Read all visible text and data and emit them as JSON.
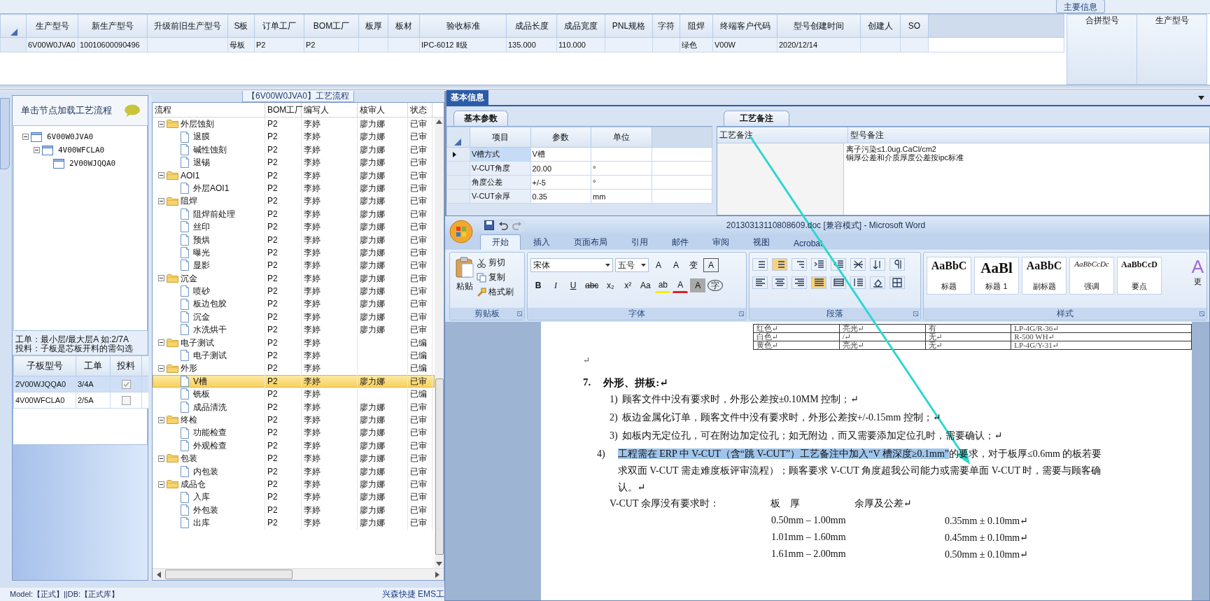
{
  "top_panel": {
    "title": "主要信息",
    "main_table": {
      "columns": [
        "生产型号",
        "新生产型号",
        "升级前旧生产型号",
        "S板",
        "订单工厂",
        "BOM工厂",
        "板厚",
        "板材",
        "验收标准",
        "成品长度",
        "成品宽度",
        "PNL规格",
        "字符",
        "阻焊",
        "终端客户代码",
        "型号创建时间",
        "创建人",
        "SO"
      ],
      "rows": [
        [
          "6V00W0JVA0",
          "10010600090496",
          null,
          "母板",
          "P2",
          "P2",
          null,
          null,
          "IPC-6012 Ⅱ级",
          "135.000",
          "110.000",
          null,
          null,
          "绿色",
          "V00W",
          "2020/12/14",
          null,
          null
        ]
      ]
    },
    "merge_table": {
      "columns": [
        "合拼型号",
        "生产型号"
      ]
    }
  },
  "left_panel": {
    "hint": "单击节点加载工艺流程",
    "tree": [
      {
        "label": "6V00W0JVA0",
        "expanded": true,
        "children": [
          {
            "label": "4V00WFCLA0",
            "expanded": true,
            "children": [
              {
                "label": "2V00WJQQA0"
              }
            ]
          }
        ]
      }
    ],
    "notes": [
      "工单：最小层/最大层A 如:2/7A",
      "投料：子板是芯板开料的需勾选"
    ],
    "sub_table": {
      "columns": [
        "子板型号",
        "工单",
        "投料"
      ],
      "rows": [
        {
          "cells": [
            "2V00WJQQA0",
            "3/4A"
          ],
          "checked": true,
          "selected": true
        },
        {
          "cells": [
            "4V00WFCLA0",
            "2/5A"
          ],
          "checked": false,
          "selected": false
        }
      ]
    }
  },
  "process_panel": {
    "title": "【6V00W0JVA0】工艺流程",
    "columns": [
      "流程",
      "BOM工厂",
      "编写人",
      "核审人",
      "状态"
    ],
    "steps": [
      {
        "label": "外层蚀刻",
        "kind": "folder",
        "factory": "P2",
        "writer": "李婷",
        "reviewer": "廖力娜",
        "status": "已审",
        "expanded": true,
        "selected": false,
        "children": [
          {
            "label": "退膜",
            "kind": "doc",
            "factory": "P2",
            "writer": "李婷",
            "reviewer": "廖力娜",
            "status": "已审",
            "selected": false
          },
          {
            "label": "碱性蚀刻",
            "kind": "doc",
            "factory": "P2",
            "writer": "李婷",
            "reviewer": "廖力娜",
            "status": "已审",
            "selected": false
          },
          {
            "label": "退锡",
            "kind": "doc",
            "factory": "P2",
            "writer": "李婷",
            "reviewer": "廖力娜",
            "status": "已审",
            "selected": false
          }
        ]
      },
      {
        "label": "AOI1",
        "kind": "folder",
        "factory": "P2",
        "writer": "李婷",
        "reviewer": "廖力娜",
        "status": "已审",
        "expanded": true,
        "selected": false,
        "children": [
          {
            "label": "外层AOI1",
            "kind": "doc",
            "factory": "P2",
            "writer": "李婷",
            "reviewer": "廖力娜",
            "status": "已审",
            "selected": false
          }
        ]
      },
      {
        "label": "阻焊",
        "kind": "folder",
        "factory": "P2",
        "writer": "李婷",
        "reviewer": "廖力娜",
        "status": "已审",
        "expanded": true,
        "selected": false,
        "children": [
          {
            "label": "阻焊前处理",
            "kind": "doc",
            "factory": "P2",
            "writer": "李婷",
            "reviewer": "廖力娜",
            "status": "已审",
            "selected": false
          },
          {
            "label": "丝印",
            "kind": "doc",
            "factory": "P2",
            "writer": "李婷",
            "reviewer": "廖力娜",
            "status": "已审",
            "selected": false
          },
          {
            "label": "预烘",
            "kind": "doc",
            "factory": "P2",
            "writer": "李婷",
            "reviewer": "廖力娜",
            "status": "已审",
            "selected": false
          },
          {
            "label": "曝光",
            "kind": "doc",
            "factory": "P2",
            "writer": "李婷",
            "reviewer": "廖力娜",
            "status": "已审",
            "selected": false
          },
          {
            "label": "显影",
            "kind": "doc",
            "factory": "P2",
            "writer": "李婷",
            "reviewer": "廖力娜",
            "status": "已审",
            "selected": false
          }
        ]
      },
      {
        "label": "沉金",
        "kind": "folder",
        "factory": "P2",
        "writer": "李婷",
        "reviewer": "廖力娜",
        "status": "已审",
        "expanded": true,
        "selected": false,
        "children": [
          {
            "label": "喷砂",
            "kind": "doc",
            "factory": "P2",
            "writer": "李婷",
            "reviewer": "廖力娜",
            "status": "已审",
            "selected": false
          },
          {
            "label": "板边包胶",
            "kind": "doc",
            "factory": "P2",
            "writer": "李婷",
            "reviewer": "廖力娜",
            "status": "已审",
            "selected": false
          },
          {
            "label": "沉金",
            "kind": "doc",
            "factory": "P2",
            "writer": "李婷",
            "reviewer": "廖力娜",
            "status": "已审",
            "selected": false
          },
          {
            "label": "水洗烘干",
            "kind": "doc",
            "factory": "P2",
            "writer": "李婷",
            "reviewer": "廖力娜",
            "status": "已审",
            "selected": false
          }
        ]
      },
      {
        "label": "电子测试",
        "kind": "folder",
        "factory": "P2",
        "writer": "李婷",
        "status": "已编",
        "expanded": true,
        "selected": false,
        "children": [
          {
            "label": "电子测试",
            "kind": "doc",
            "factory": "P2",
            "writer": "李婷",
            "status": "已编",
            "selected": false
          }
        ]
      },
      {
        "label": "外形",
        "kind": "folder",
        "factory": "P2",
        "writer": "李婷",
        "status": "已编",
        "expanded": true,
        "selected": false,
        "children": [
          {
            "label": "V槽",
            "kind": "doc",
            "factory": "P2",
            "writer": "李婷",
            "reviewer": "廖力娜",
            "status": "已审",
            "selected": true
          },
          {
            "label": "铣板",
            "kind": "doc",
            "factory": "P2",
            "writer": "李婷",
            "status": "已编",
            "selected": false
          },
          {
            "label": "成品清洗",
            "kind": "doc",
            "factory": "P2",
            "writer": "李婷",
            "reviewer": "廖力娜",
            "status": "已审",
            "selected": false
          }
        ]
      },
      {
        "label": "终检",
        "kind": "folder",
        "factory": "P2",
        "writer": "李婷",
        "reviewer": "廖力娜",
        "status": "已审",
        "expanded": true,
        "selected": false,
        "children": [
          {
            "label": "功能检查",
            "kind": "doc",
            "factory": "P2",
            "writer": "李婷",
            "reviewer": "廖力娜",
            "status": "已审",
            "selected": false
          },
          {
            "label": "外观检查",
            "kind": "doc",
            "factory": "P2",
            "writer": "李婷",
            "reviewer": "廖力娜",
            "status": "已审",
            "selected": false
          }
        ]
      },
      {
        "label": "包装",
        "kind": "folder",
        "factory": "P2",
        "writer": "李婷",
        "reviewer": "廖力娜",
        "status": "已审",
        "expanded": true,
        "selected": false,
        "children": [
          {
            "label": "内包装",
            "kind": "doc",
            "factory": "P2",
            "writer": "李婷",
            "reviewer": "廖力娜",
            "status": "已审",
            "selected": false
          }
        ]
      },
      {
        "label": "成品仓",
        "kind": "folder",
        "factory": "P2",
        "writer": "李婷",
        "reviewer": "廖力娜",
        "status": "已审",
        "expanded": true,
        "selected": false,
        "children": [
          {
            "label": "入库",
            "kind": "doc",
            "factory": "P2",
            "writer": "李婷",
            "reviewer": "廖力娜",
            "status": "已审",
            "selected": false
          },
          {
            "label": "外包装",
            "kind": "doc",
            "factory": "P2",
            "writer": "李婷",
            "reviewer": "廖力娜",
            "status": "已审",
            "selected": false
          },
          {
            "label": "出库",
            "kind": "doc",
            "factory": "P2",
            "writer": "李婷",
            "reviewer": "廖力娜",
            "status": "已审",
            "selected": false
          }
        ]
      }
    ]
  },
  "info_panel": {
    "tab": "基本信息",
    "params": {
      "tab": "基本参数",
      "columns": [
        "项目",
        "参数",
        "单位"
      ],
      "rows": [
        {
          "cells": [
            "V槽方式",
            "V槽"
          ],
          "selected": true
        },
        {
          "cells": [
            "V-CUT角度",
            "20.00",
            "°"
          ],
          "selected": false
        },
        {
          "cells": [
            "角度公差",
            "+/-5",
            "°"
          ],
          "selected": false
        },
        {
          "cells": [
            "V-CUT余厚",
            "0.35",
            "mm"
          ],
          "selected": false
        }
      ]
    },
    "remarks": {
      "tab": "工艺备注",
      "columns": [
        "工艺备注",
        "型号备注"
      ],
      "model_notes": [
        "离子污染≤1.0ug.CaCl/cm2",
        "铜厚公差和介质厚度公差按ipc标准"
      ]
    }
  },
  "word": {
    "title": "20130313110808609.doc [兼容模式] - Microsoft Word",
    "tabs": [
      {
        "label": "开始",
        "selected": true
      },
      {
        "label": "插入",
        "selected": false
      },
      {
        "label": "页面布局",
        "selected": false
      },
      {
        "label": "引用",
        "selected": false
      },
      {
        "label": "邮件",
        "selected": false
      },
      {
        "label": "审阅",
        "selected": false
      },
      {
        "label": "视图",
        "selected": false
      },
      {
        "label": "Acrobat",
        "selected": false
      }
    ],
    "clipboard": {
      "paste": "粘贴",
      "items": [
        "剪切",
        "复制",
        "格式刷"
      ],
      "label": "剪贴板"
    },
    "font": {
      "name": "宋体",
      "size": "五号",
      "tools": [
        "A",
        "A",
        "变",
        "A"
      ],
      "buttons": [
        {
          "label": "B",
          "kind": "bold"
        },
        {
          "label": "I",
          "kind": "italic"
        },
        {
          "label": "U",
          "kind": "underline"
        },
        {
          "label": "abc",
          "kind": "strike"
        },
        {
          "label": "x₂",
          "kind": "plain"
        },
        {
          "label": "x²",
          "kind": "plain"
        },
        {
          "label": "Aa",
          "kind": "plain"
        },
        {
          "label": "ab",
          "kind": "highlight"
        },
        {
          "label": "A",
          "kind": "color"
        },
        {
          "label": "A",
          "kind": "shade"
        },
        {
          "label": "字",
          "kind": "circle"
        }
      ],
      "label": "字体"
    },
    "paragraph": {
      "label": "段落",
      "row1": [
        {
          "kind": "bullets",
          "on": false
        },
        {
          "kind": "numbering",
          "on": true
        },
        {
          "kind": "multilevel",
          "on": false
        },
        {
          "kind": "outdent",
          "on": false
        },
        {
          "kind": "indent",
          "on": false
        },
        {
          "kind": "layout",
          "on": false
        },
        {
          "kind": "sort",
          "on": false
        },
        {
          "kind": "marks",
          "on": false
        }
      ],
      "row2": [
        {
          "kind": "left",
          "on": false
        },
        {
          "kind": "center",
          "on": false
        },
        {
          "kind": "right",
          "on": false
        },
        {
          "kind": "justify",
          "on": true
        },
        {
          "kind": "distributed",
          "on": false
        },
        {
          "kind": "spacing",
          "on": false
        },
        {
          "kind": "shading",
          "on": false
        },
        {
          "kind": "borders",
          "on": false
        }
      ]
    },
    "styles": {
      "items": [
        {
          "sample": "AaBbC",
          "name": "标题",
          "kind": "title"
        },
        {
          "sample": "AaBl",
          "name": "标题 1",
          "kind": "heading"
        },
        {
          "sample": "AaBbC",
          "name": "副标题",
          "kind": "title"
        },
        {
          "sample": "AaBbCcDc",
          "name": "强调",
          "kind": "emphasis"
        },
        {
          "sample": "AaBbCcD",
          "name": "要点",
          "kind": "strong"
        }
      ],
      "label": "样式",
      "change_glyph": "A",
      "change": "更"
    },
    "document": {
      "color_table": [
        [
          "红色↵",
          "亮光↵",
          "有",
          "LP-4G/R-36↵"
        ],
        [
          "白色↵",
          "/↵",
          "无↵",
          "R-500 WH↵"
        ],
        [
          "黄色↵",
          "亮光↵",
          "无↵",
          "LP-4G/Y-31↵"
        ]
      ],
      "blank_mark": "↵",
      "heading": {
        "number": "7.",
        "text": "外形、拼板:↵"
      },
      "items": [
        {
          "number": "1)",
          "text": "顾客文件中没有要求时，外形公差按±0.10MM 控制；↵"
        },
        {
          "number": "2)",
          "text": "板边金属化订单，顾客文件中没有要求时，外形公差按+/-0.15mm 控制；↵"
        },
        {
          "number": "3)",
          "text": "如板内无定位孔，可在附边加定位孔；如无附边，而又需要添加定位孔时，需要确认；↵"
        },
        {
          "number": "4)",
          "highlight": "工程需在 ERP 中 V-CUT（含“跳 V-CUT”）工艺备注中加入“V 槽深度≥0.1mm”",
          "text": "的要求，对于板厚≤0.6mm 的板若要求双面 V-CUT 需走难度板评审流程）；顾客要求 V-CUT 角度超我公司能力或需要单面 V-CUT 时，需要与顾客确认。↵"
        }
      ],
      "vcut": {
        "lead": "V-CUT 余厚没有要求时：",
        "columns": [
          "板　厚",
          "余厚及公差↵"
        ],
        "rows": [
          [
            "0.50mm – 1.00mm",
            "0.35mm ± 0.10mm↵"
          ],
          [
            "1.01mm – 1.60mm",
            "0.45mm ± 0.10mm↵"
          ],
          [
            "1.61mm – 2.00mm",
            "0.50mm ± 0.10mm↵"
          ]
        ]
      }
    }
  },
  "status_bar": {
    "left": "Model:【正式】||DB:【正式库】",
    "right": "兴森快捷 EMS工"
  }
}
